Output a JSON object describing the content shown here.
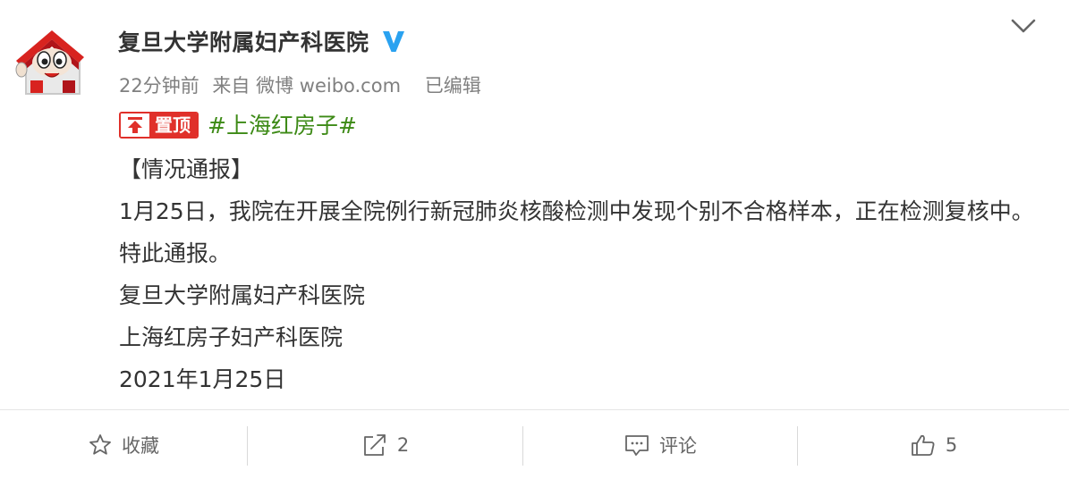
{
  "author": {
    "name": "复旦大学附属妇产科医院",
    "verified_icon": "verified-blue-v-icon",
    "avatar_icon": "red-house-mascot-avatar"
  },
  "meta": {
    "time": "22分钟前",
    "source": "来自 微博 weibo.com",
    "edited": "已编辑"
  },
  "post": {
    "pin_label": "置顶",
    "topic": "#上海红房子#",
    "lines": [
      "【情况通报】",
      "1月25日，我院在开展全院例行新冠肺炎核酸检测中发现个别不合格样本，正在检测复核中。特此通报。",
      "复旦大学附属妇产科医院",
      "上海红房子妇产科医院",
      "2021年1月25日"
    ]
  },
  "actions": {
    "favorite_label": "收藏",
    "repost_count": "2",
    "comment_label": "评论",
    "like_count": "5"
  },
  "colors": {
    "topic_green": "#3d8a16",
    "pin_red": "#e0302a",
    "verified_blue": "#2aa2f0"
  }
}
